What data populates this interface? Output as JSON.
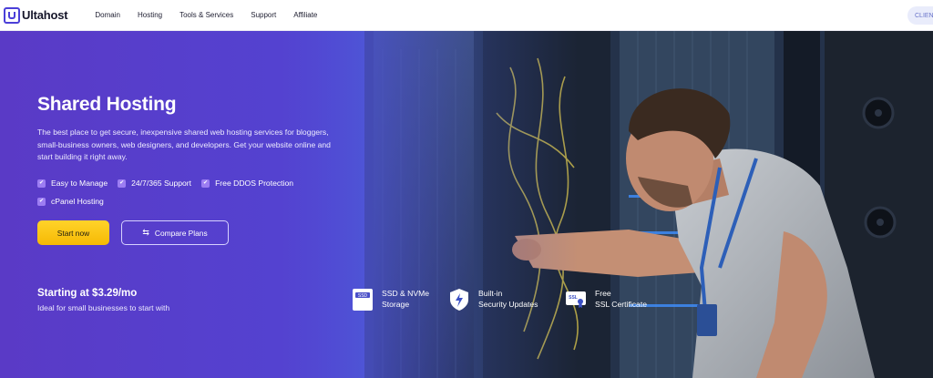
{
  "brand": {
    "name": "Ultahost"
  },
  "nav": {
    "items": [
      "Domain",
      "Hosting",
      "Tools & Services",
      "Support",
      "Affiliate"
    ],
    "client_label": "CLIENT"
  },
  "hero": {
    "title": "Shared Hosting",
    "description": "The best place to get secure, inexpensive shared web hosting services for bloggers, small-business owners, web designers, and developers. Get your website online and start building it right away.",
    "features": [
      "Easy to Manage",
      "24/7/365 Support",
      "Free DDOS Protection",
      "cPanel Hosting"
    ],
    "start_label": "Start now",
    "compare_label": "Compare Plans",
    "price_label": "Starting at $3.29/mo",
    "price_sub": "Ideal for small businesses to start with",
    "badges": [
      {
        "icon": "ssd-icon",
        "icon_text": "SSD",
        "line1": "SSD & NVMe",
        "line2": "Storage"
      },
      {
        "icon": "shield-bolt-icon",
        "line1": "Built-in",
        "line2": "Security Updates"
      },
      {
        "icon": "ssl-certificate-icon",
        "icon_text": "SSL",
        "line1": "Free",
        "line2": "SSL Certificate"
      }
    ]
  },
  "colors": {
    "brand": "#4b3fd8",
    "hero_gradient_start": "#5a3bc6",
    "start_button": "#fcc419",
    "check": "#9c7df2"
  }
}
